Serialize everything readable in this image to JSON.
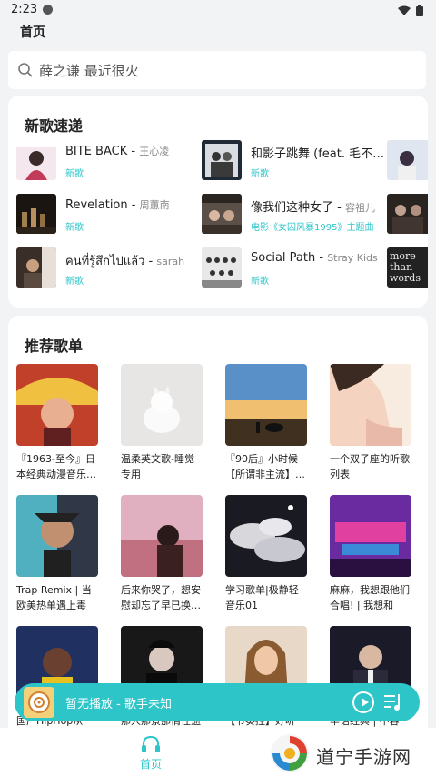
{
  "status": {
    "time": "2:23"
  },
  "header": {
    "title": "首页"
  },
  "search": {
    "placeholder": "薛之谦 最近很火"
  },
  "new_songs": {
    "title": "新歌速递",
    "items": [
      {
        "title": "BITE BACK",
        "artist": "王心凌",
        "tag": "新歌"
      },
      {
        "title": "和影子跳舞 (feat. 毛不…",
        "artist": "",
        "tag": "新歌"
      },
      {
        "title": "Revelation",
        "artist": "周蕙南",
        "tag": "新歌"
      },
      {
        "title": "像我们这种女子",
        "artist": "容祖儿",
        "tag": "电影《女囚风暴1995》主题曲"
      },
      {
        "title": "คนที่รู้สึกไปแล้ว",
        "artist": "sarah",
        "tag": "新歌"
      },
      {
        "title": "Social Path",
        "artist": "Stray Kids",
        "tag": "新歌"
      }
    ],
    "side_cover_text": "more than words"
  },
  "playlists": {
    "title": "推荐歌单",
    "items": [
      {
        "name": "『1963-至今』日本经典动漫音乐…"
      },
      {
        "name": "温柔英文歌-睡觉专用"
      },
      {
        "name": "『90后』小时候【所谓非主流】…"
      },
      {
        "name": "一个双子座的听歌列表"
      },
      {
        "name": "Trap Remix | 当欧美热单遇上毒性…"
      },
      {
        "name": "后来你哭了，想安慰却忘了早已换…"
      },
      {
        "name": "学习歌单|极静轻音乐01"
      },
      {
        "name": "麻麻，我想跟他们合唱! | 我想和你…"
      },
      {
        "name": "国产HipHop从地…"
      },
      {
        "name": "那人那景那情往逝"
      },
      {
        "name": "【节奏控】好听又…"
      },
      {
        "name": "华语经典 | 不容错…"
      }
    ]
  },
  "player": {
    "text": "暂无播放 - 歌手未知"
  },
  "nav": {
    "home_label": "首页"
  },
  "watermark": {
    "text": "道宁手游网"
  },
  "colors": {
    "accent": "#2ec5c8",
    "background": "#f2f3f5",
    "card": "#ffffff"
  }
}
